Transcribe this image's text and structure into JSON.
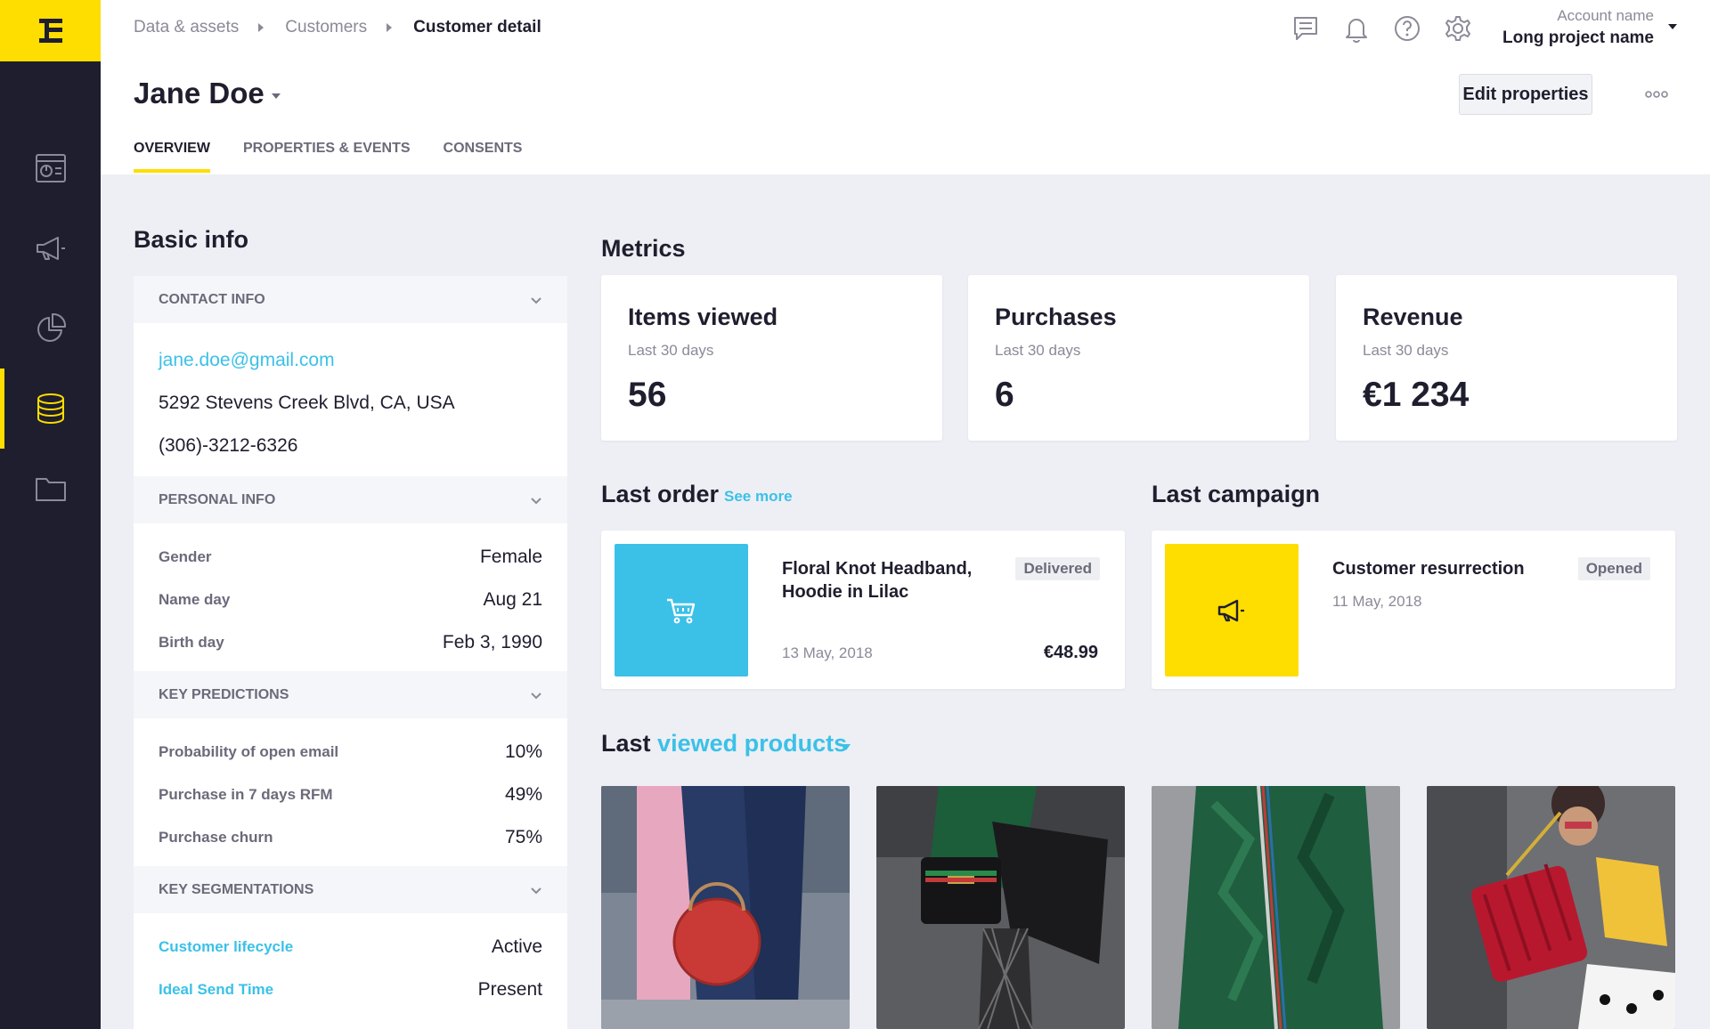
{
  "colors": {
    "brand_yellow": "#fedd00",
    "sidebar_dark": "#1f1e2e",
    "accent_cyan": "#3bc1e8",
    "background": "#eeeff4"
  },
  "sidebar": {
    "logo_icon": "brand-logo-icon",
    "items": [
      {
        "icon": "dashboard-icon"
      },
      {
        "icon": "campaigns-megaphone-icon"
      },
      {
        "icon": "analytics-pie-icon"
      },
      {
        "icon": "data-database-icon"
      },
      {
        "icon": "assets-folder-icon"
      }
    ],
    "active_item": "data-database-icon"
  },
  "header": {
    "breadcrumb": [
      "Data & assets",
      "Customers",
      "Customer detail"
    ],
    "icons": [
      "chat-icon",
      "bell-icon",
      "help-icon",
      "gear-icon"
    ],
    "account_name": "Account name",
    "project_name": "Long project name",
    "title": "Jane Doe",
    "edit_button": "Edit properties",
    "tabs": [
      "OVERVIEW",
      "PROPERTIES & EVENTS",
      "CONSENTS"
    ],
    "active_tab": "OVERVIEW"
  },
  "basic_info": {
    "title": "Basic info",
    "contact": {
      "label": "CONTACT INFO",
      "email": "jane.doe@gmail.com",
      "address": "5292 Stevens Creek Blvd, CA, USA",
      "phone": "(306)-3212-6326"
    },
    "personal": {
      "label": "PERSONAL INFO",
      "rows": [
        {
          "key": "Gender",
          "value": "Female"
        },
        {
          "key": "Name day",
          "value": "Aug 21"
        },
        {
          "key": "Birth day",
          "value": "Feb 3, 1990"
        }
      ]
    },
    "predictions": {
      "label": "KEY PREDICTIONS",
      "rows": [
        {
          "key": "Probability of open email",
          "value": "10%"
        },
        {
          "key": "Purchase in 7 days RFM",
          "value": "49%"
        },
        {
          "key": "Purchase churn",
          "value": "75%"
        }
      ]
    },
    "segmentations": {
      "label": "KEY SEGMENTATIONS",
      "rows": [
        {
          "key": "Customer lifecycle",
          "value": "Active"
        },
        {
          "key": "Ideal Send Time",
          "value": "Present"
        }
      ]
    }
  },
  "metrics": {
    "title": "Metrics",
    "cards": [
      {
        "title": "Items viewed",
        "subtitle": "Last 30 days",
        "value": "56"
      },
      {
        "title": "Purchases",
        "subtitle": "Last 30 days",
        "value": "6"
      },
      {
        "title": "Revenue",
        "subtitle": "Last 30 days",
        "value": "€1 234"
      }
    ]
  },
  "last_order": {
    "title": "Last order",
    "see_more": "See more",
    "product": "Floral Knot Headband, Hoodie in Lilac",
    "status": "Delivered",
    "date": "13 May, 2018",
    "price": "€48.99",
    "icon": "shopping-cart-icon"
  },
  "last_campaign": {
    "title": "Last campaign",
    "name": "Customer resurrection",
    "status": "Opened",
    "date": "11 May, 2018",
    "icon": "megaphone-icon"
  },
  "viewed_products": {
    "title_prefix": "Last",
    "title_accent": "viewed products",
    "items": [
      {
        "image": "red-round-handbag-photo"
      },
      {
        "image": "black-handbag-fishnet-photo"
      },
      {
        "image": "green-fur-coat-photo"
      },
      {
        "image": "red-quilted-handbag-photo"
      }
    ]
  }
}
